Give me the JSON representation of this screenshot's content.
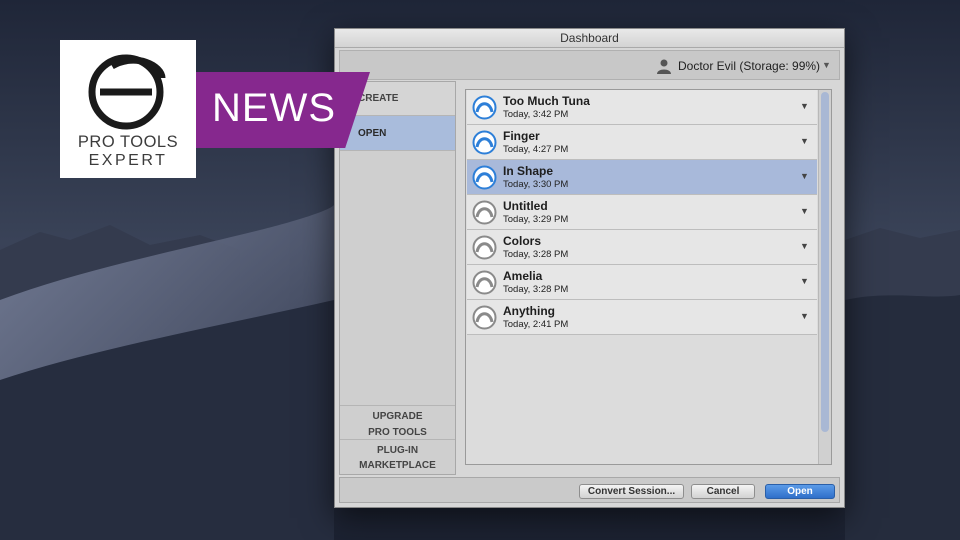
{
  "logo": {
    "line1": "PRO TOOLS",
    "line2": "EXPERT",
    "banner": "NEWS"
  },
  "window": {
    "title": "Dashboard",
    "user_label": "Doctor Evil (Storage: 99%)",
    "user_icon": "person-icon"
  },
  "sidebar": {
    "create": "CREATE",
    "open": "OPEN",
    "upgrade_line1": "UPGRADE",
    "upgrade_line2": "PRO TOOLS",
    "market_line1": "PLUG-IN",
    "market_line2": "MARKETPLACE"
  },
  "sessions": [
    {
      "name": "Too Much Tuna",
      "time": "Today, 3:42 PM",
      "icon_color": "#2d7fd8"
    },
    {
      "name": "Finger",
      "time": "Today, 4:27 PM",
      "icon_color": "#2d7fd8"
    },
    {
      "name": "In Shape",
      "time": "Today, 3:30 PM",
      "icon_color": "#2d7fd8"
    },
    {
      "name": "Untitled",
      "time": "Today, 3:29 PM",
      "icon_color": "#8a8a8a"
    },
    {
      "name": "Colors",
      "time": "Today, 3:28 PM",
      "icon_color": "#8a8a8a"
    },
    {
      "name": "Amelia",
      "time": "Today, 3:28 PM",
      "icon_color": "#8a8a8a"
    },
    {
      "name": "Anything",
      "time": "Today, 2:41 PM",
      "icon_color": "#8a8a8a"
    }
  ],
  "buttons": {
    "convert": "Convert Session...",
    "cancel": "Cancel",
    "open": "Open"
  },
  "colors": {
    "brand_purple": "#86288e",
    "selection_blue": "#a8b9da",
    "primary_button": "#2f6fc9"
  }
}
